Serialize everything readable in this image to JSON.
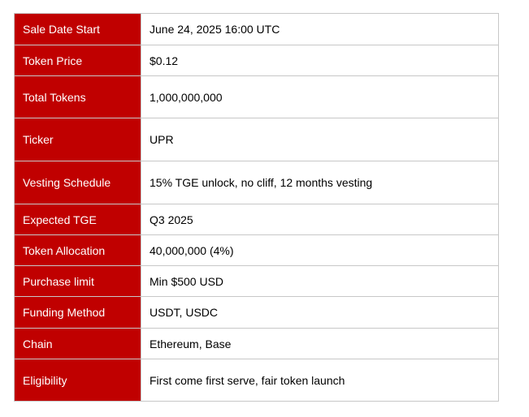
{
  "sale_details": {
    "rows": [
      {
        "label": "Sale Date Start",
        "value": "June 24, 2025 16:00 UTC"
      },
      {
        "label": "Token Price",
        "value": "$0.12"
      },
      {
        "label": "Total Tokens",
        "value": "1,000,000,000"
      },
      {
        "label": "Ticker",
        "value": "UPR"
      },
      {
        "label": "Vesting Schedule",
        "value": "15% TGE unlock, no cliff, 12 months vesting"
      },
      {
        "label": "Expected TGE",
        "value": "Q3 2025"
      },
      {
        "label": "Token Allocation",
        "value": "40,000,000 (4%)"
      },
      {
        "label": "Purchase limit",
        "value": "Min $500 USD"
      },
      {
        "label": "Funding Method",
        "value": "USDT, USDC"
      },
      {
        "label": "Chain",
        "value": "Ethereum, Base"
      },
      {
        "label": "Eligibility",
        "value": "First come first serve, fair token launch"
      }
    ]
  },
  "colors": {
    "label_background": "#c00000",
    "label_text": "#ffffff",
    "border": "#c7c7c7"
  }
}
